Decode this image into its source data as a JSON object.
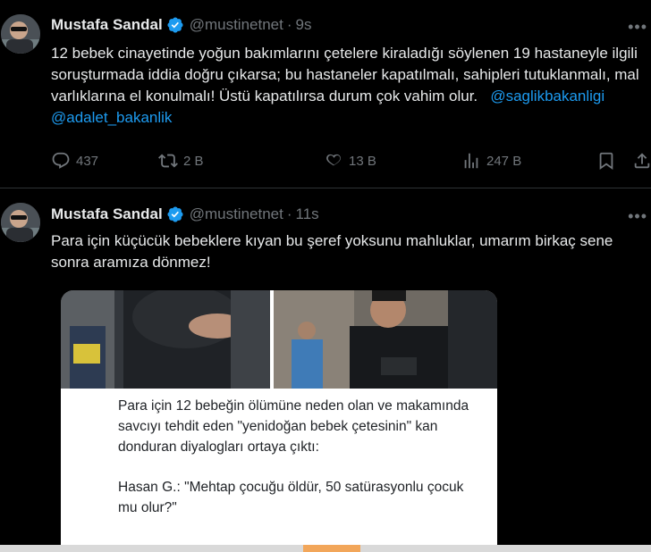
{
  "tweets": [
    {
      "name": "Mustafa Sandal",
      "handle": "@mustinetnet",
      "dot": "·",
      "time": "9s",
      "text": "12 bebek cinayetinde yoğun bakımlarını çetelere kiraladığı söylenen 19 hastaneyle ilgili soruşturmada iddia doğru çıkarsa; bu hastaneler kapatılmalı, sahipleri tutuklanmalı, mal varlıklarına el konulmalı! Üstü kapatılırsa durum çok vahim olur.",
      "mentions": [
        "@saglikbakanligi",
        "@adalet_bakanlik"
      ],
      "replies": "437",
      "reposts": "2 B",
      "likes": "13 B",
      "views": "247 B"
    },
    {
      "name": "Mustafa Sandal",
      "handle": "@mustinetnet",
      "dot": "·",
      "time": "11s",
      "text": "Para için küçücük bebeklere kıyan bu şeref yoksunu mahluklar, umarım birkaç sene sonra aramıza dönmez!",
      "media": {
        "caption_lines": [
          "Para için 12 bebeğin ölümüne neden olan ve makamında savcıyı tehdit eden \"yenidoğan bebek çetesinin\" kan donduran diyalogları ortaya çıktı:",
          "Hasan G.: \"Mehtap çocuğu öldür, 50 satürasyonlu çocuk mu olur?\""
        ]
      }
    }
  ],
  "colors": {
    "background": "#000000",
    "text": "#e7e9ea",
    "muted": "#71767b",
    "link": "#1d9bf0",
    "verified": "#1d9bf0"
  },
  "icons": [
    "verified-badge-icon",
    "more-icon",
    "reply-icon",
    "repost-icon",
    "like-icon",
    "views-icon",
    "bookmark-icon",
    "share-icon"
  ]
}
